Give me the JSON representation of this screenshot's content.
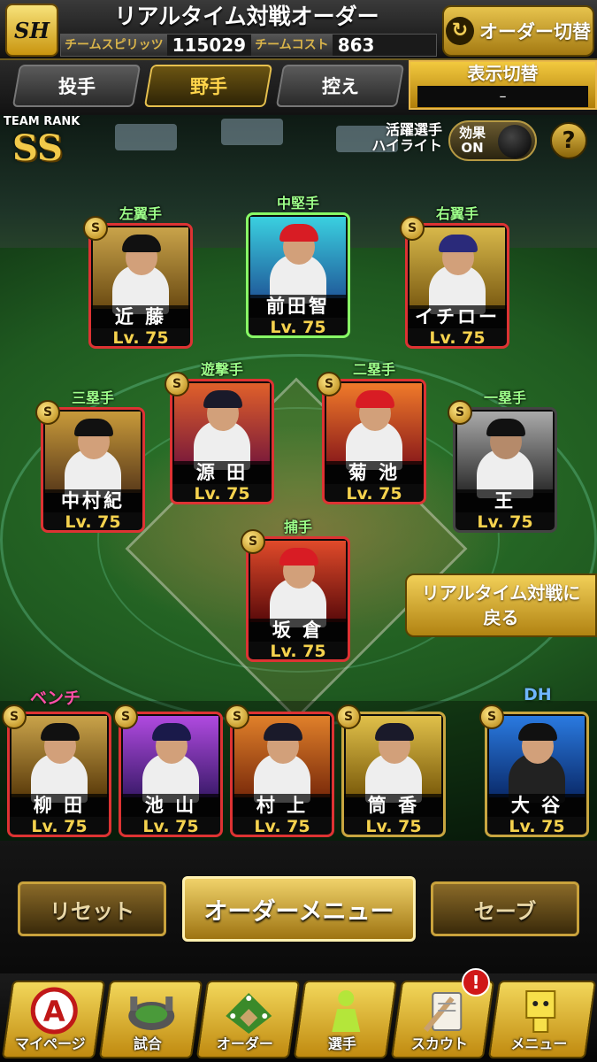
{
  "header": {
    "logo_text": "SH",
    "title": "リアルタイム対戦オーダー",
    "team_spirit_label": "チームスピリッツ",
    "team_spirit_value": "115029",
    "team_cost_label": "チームコスト",
    "team_cost_value": "863",
    "order_switch_label": "オーダー切替",
    "order_switch_icon": "swap-arrows-icon"
  },
  "tabs": [
    {
      "label": "投手",
      "active": false
    },
    {
      "label": "野手",
      "active": true
    },
    {
      "label": "控え",
      "active": false
    }
  ],
  "display_toggle": {
    "label": "表示切替",
    "value": "–"
  },
  "team_rank": {
    "label": "TEAM RANK",
    "value": "SS"
  },
  "highlight": {
    "label_line1": "活躍選手",
    "label_line2": "ハイライト",
    "effect_line1": "効果",
    "effect_line2": "ON"
  },
  "help_label": "?",
  "positions": {
    "left": {
      "pos": "左翼手",
      "name": "近 藤",
      "lv": "Lv. 75"
    },
    "center": {
      "pos": "中堅手",
      "name": "前田智",
      "lv": "Lv. 75"
    },
    "right": {
      "pos": "右翼手",
      "name": "イチロー",
      "lv": "Lv. 75"
    },
    "short": {
      "pos": "遊撃手",
      "name": "源 田",
      "lv": "Lv. 75"
    },
    "second": {
      "pos": "二塁手",
      "name": "菊 池",
      "lv": "Lv. 75"
    },
    "third": {
      "pos": "三塁手",
      "name": "中村紀",
      "lv": "Lv. 75"
    },
    "first": {
      "pos": "一塁手",
      "name": "王",
      "lv": "Lv. 75"
    },
    "catcher": {
      "pos": "捕手",
      "name": "坂 倉",
      "lv": "Lv. 75"
    }
  },
  "badge_letter": "S",
  "bench": {
    "label": "ベンチ",
    "players": [
      {
        "name": "柳 田",
        "lv": "Lv. 75"
      },
      {
        "name": "池 山",
        "lv": "Lv. 75"
      },
      {
        "name": "村 上",
        "lv": "Lv. 75"
      },
      {
        "name": "筒 香",
        "lv": "Lv. 75"
      }
    ]
  },
  "dh": {
    "label": "DH",
    "name": "大 谷",
    "lv": "Lv. 75"
  },
  "return_button": {
    "line1": "リアルタイム対戦に",
    "line2": "戻る"
  },
  "actions": {
    "reset": "リセット",
    "order_menu": "オーダーメニュー",
    "save": "セーブ"
  },
  "nav": [
    {
      "label": "マイページ",
      "icon": "mypage-icon"
    },
    {
      "label": "試合",
      "icon": "stadium-icon"
    },
    {
      "label": "オーダー",
      "icon": "field-order-icon"
    },
    {
      "label": "選手",
      "icon": "player-icon"
    },
    {
      "label": "スカウト",
      "icon": "scout-icon"
    },
    {
      "label": "メニュー",
      "icon": "menu-icon"
    }
  ],
  "notification_badge": "!",
  "colors": {
    "gold": "#e6c04e",
    "accent_green": "#9dff8a",
    "bench_pink": "#ff4fa8",
    "dh_blue": "#6fb6ff"
  }
}
